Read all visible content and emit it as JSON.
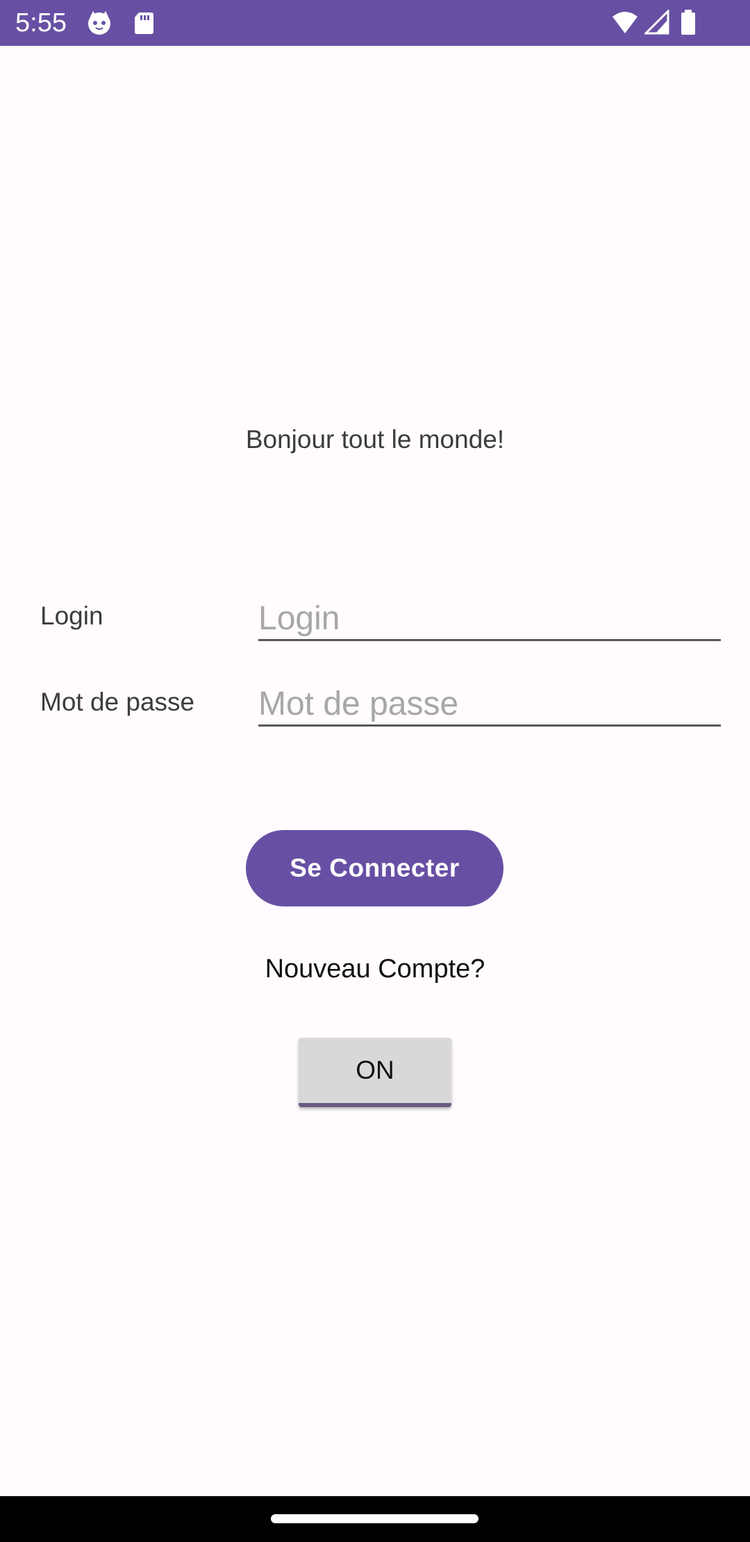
{
  "status_bar": {
    "time": "5:55",
    "background_color": "#6750a4",
    "left_icons": [
      "cat-face-icon",
      "sd-card-icon"
    ],
    "right_icons": [
      "wifi-icon",
      "signal-icon",
      "battery-icon"
    ]
  },
  "main": {
    "greeting": "Bonjour tout le monde!",
    "login": {
      "label": "Login",
      "placeholder": "Login",
      "value": ""
    },
    "password": {
      "label": "Mot de passe",
      "placeholder": "Mot de passe",
      "value": ""
    },
    "connect_button_label": "Se Connecter",
    "new_account_link": "Nouveau Compte?",
    "toggle_label": "ON"
  },
  "colors": {
    "accent": "#6750a4",
    "background": "#fffbfe",
    "toggle_background": "#d7d8d7"
  }
}
